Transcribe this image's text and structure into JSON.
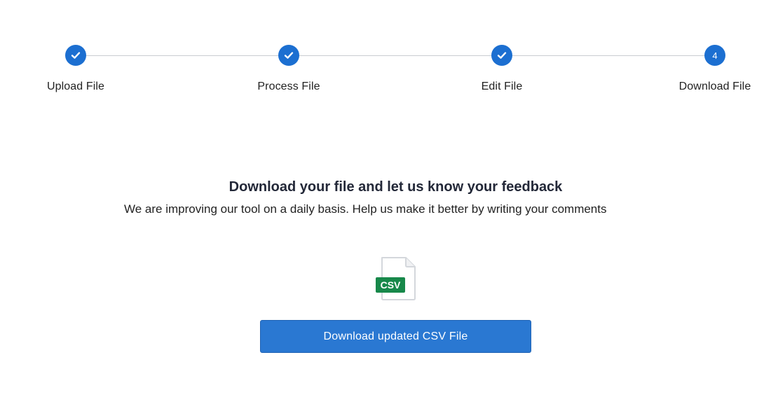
{
  "stepper": {
    "steps": [
      {
        "label": "Upload File",
        "status": "completed",
        "icon": "check-icon"
      },
      {
        "label": "Process File",
        "status": "completed",
        "icon": "check-icon"
      },
      {
        "label": "Edit File",
        "status": "completed",
        "icon": "check-icon"
      },
      {
        "label": "Download File",
        "status": "current",
        "number": "4"
      }
    ]
  },
  "main": {
    "title": "Download your file and let us know your feedback",
    "description": "We are improving our tool on a daily basis. Help us make it better by writing your comments",
    "file_icon": {
      "name": "csv-file-icon",
      "badge_text": "CSV",
      "badge_color": "#17884a"
    },
    "download_button_label": "Download updated CSV File"
  },
  "colors": {
    "accent": "#1c6fd1",
    "button": "#2a78d2",
    "divider": "#c9ccd1",
    "text": "#222222",
    "title": "#232838"
  }
}
